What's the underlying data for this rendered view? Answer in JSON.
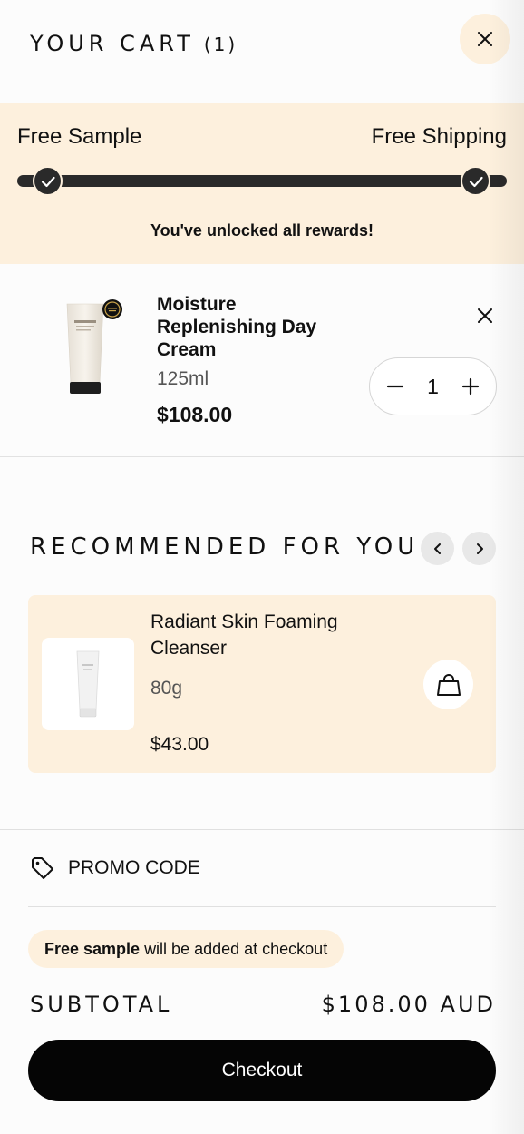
{
  "header": {
    "title": "YOUR CART",
    "count": "(1)",
    "close_icon": "close-icon"
  },
  "rewards": {
    "left_label": "Free Sample",
    "right_label": "Free Shipping",
    "progress": 1.0,
    "message": "You've unlocked all rewards!",
    "check_icon": "check-icon"
  },
  "cart_item": {
    "name": "Moisture Replenishing Day Cream",
    "size": "125ml",
    "price": "$108.00",
    "quantity": "1",
    "remove_icon": "close-icon",
    "minus_icon": "minus-icon",
    "plus_icon": "plus-icon",
    "thumbnail_brand": "Jurlique"
  },
  "recommended": {
    "title": "RECOMMENDED FOR YOU",
    "prev_icon": "chevron-left-icon",
    "next_icon": "chevron-right-icon",
    "items": [
      {
        "name": "Radiant Skin Foaming Cleanser",
        "size": "80g",
        "price": "$43.00",
        "action_icon": "shopping-bag-icon"
      }
    ]
  },
  "promo": {
    "label": "PROMO CODE",
    "icon": "tag-icon"
  },
  "sample_notice": {
    "bold": "Free sample",
    "rest": "will be added at checkout"
  },
  "summary": {
    "subtotal_label": "SUBTOTAL",
    "subtotal_value": "$108.00 AUD",
    "checkout_label": "Checkout"
  },
  "colors": {
    "accent_cream": "#fdf0dd",
    "dark": "#2a2a2a",
    "checkout_bg": "#050505"
  }
}
